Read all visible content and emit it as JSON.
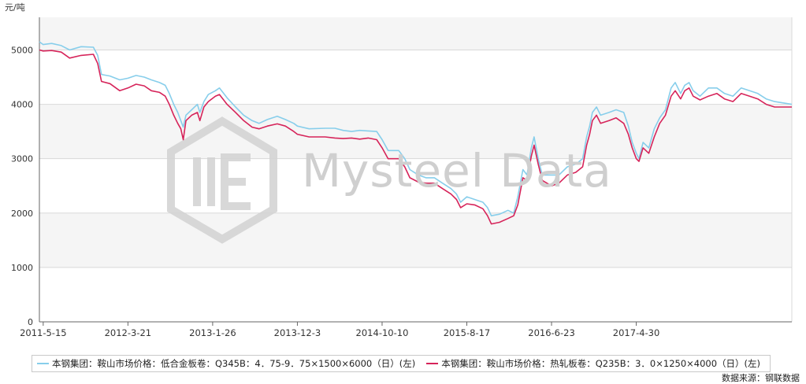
{
  "unit_label": "元/吨",
  "watermark": "Mysteel Data",
  "source": "数据来源：钢联数据",
  "legend": [
    {
      "label": "本钢集团：鞍山市场价格：低合金板卷：Q345B：4．75-9．75×1500×6000（日）(左)",
      "color": "#87ceeb"
    },
    {
      "label": "本钢集团：鞍山市场价格：热轧板卷：Q235B：3．0×1250×4000（日）(左)",
      "color": "#d6245a"
    }
  ],
  "colors": {
    "band": "#f5f5f5",
    "grid": "#d9d9d9",
    "axis": "#666666",
    "brand_mark": "#d4d4d4"
  },
  "chart_data": {
    "type": "line",
    "title": "",
    "xlabel": "",
    "ylabel": "元/吨",
    "ylim": [
      0,
      5600
    ],
    "yticks": [
      0,
      1000,
      2000,
      3000,
      4000,
      5000
    ],
    "xlim": [
      "2011-05-01",
      "2018-11-22"
    ],
    "xticks": [
      "2011-5-15",
      "2012-3-21",
      "2013-1-26",
      "2013-12-3",
      "2014-10-10",
      "2015-8-17",
      "2016-6-23",
      "2017-4-30"
    ],
    "grid": true,
    "legend_position": "bottom",
    "series": [
      {
        "name": "本钢集团：鞍山市场价格：低合金板卷：Q345B：4．75-9．75×1500×6000（日）(左)",
        "color": "#87ceeb",
        "points": [
          [
            "2011-05-01",
            5150
          ],
          [
            "2011-05-15",
            5100
          ],
          [
            "2011-06-15",
            5120
          ],
          [
            "2011-07-20",
            5080
          ],
          [
            "2011-08-20",
            5000
          ],
          [
            "2011-10-01",
            5060
          ],
          [
            "2011-11-15",
            5050
          ],
          [
            "2011-12-01",
            4900
          ],
          [
            "2011-12-15",
            4550
          ],
          [
            "2012-01-15",
            4520
          ],
          [
            "2012-02-20",
            4450
          ],
          [
            "2012-03-21",
            4480
          ],
          [
            "2012-04-20",
            4530
          ],
          [
            "2012-05-20",
            4500
          ],
          [
            "2012-06-15",
            4450
          ],
          [
            "2012-07-15",
            4400
          ],
          [
            "2012-08-05",
            4350
          ],
          [
            "2012-08-20",
            4200
          ],
          [
            "2012-09-05",
            4000
          ],
          [
            "2012-09-20",
            3850
          ],
          [
            "2012-10-01",
            3700
          ],
          [
            "2012-10-10",
            3580
          ],
          [
            "2012-10-20",
            3800
          ],
          [
            "2012-11-10",
            3900
          ],
          [
            "2012-12-01",
            4000
          ],
          [
            "2012-12-10",
            3850
          ],
          [
            "2012-12-25",
            4050
          ],
          [
            "2013-01-10",
            4180
          ],
          [
            "2013-02-05",
            4250
          ],
          [
            "2013-02-20",
            4300
          ],
          [
            "2013-03-20",
            4120
          ],
          [
            "2013-04-20",
            3950
          ],
          [
            "2013-05-20",
            3800
          ],
          [
            "2013-06-20",
            3700
          ],
          [
            "2013-07-15",
            3650
          ],
          [
            "2013-08-15",
            3720
          ],
          [
            "2013-09-20",
            3780
          ],
          [
            "2013-10-20",
            3720
          ],
          [
            "2013-11-20",
            3650
          ],
          [
            "2013-12-03",
            3600
          ],
          [
            "2014-01-15",
            3550
          ],
          [
            "2014-03-15",
            3560
          ],
          [
            "2014-04-20",
            3560
          ],
          [
            "2014-05-20",
            3520
          ],
          [
            "2014-06-20",
            3500
          ],
          [
            "2014-07-20",
            3520
          ],
          [
            "2014-08-20",
            3510
          ],
          [
            "2014-09-20",
            3500
          ],
          [
            "2014-10-10",
            3350
          ],
          [
            "2014-11-01",
            3150
          ],
          [
            "2014-12-10",
            3150
          ],
          [
            "2015-01-01",
            3000
          ],
          [
            "2015-01-20",
            2800
          ],
          [
            "2015-02-20",
            2700
          ],
          [
            "2015-03-20",
            2650
          ],
          [
            "2015-04-20",
            2650
          ],
          [
            "2015-05-20",
            2550
          ],
          [
            "2015-06-20",
            2450
          ],
          [
            "2015-07-10",
            2350
          ],
          [
            "2015-07-25",
            2200
          ],
          [
            "2015-08-17",
            2300
          ],
          [
            "2015-09-15",
            2250
          ],
          [
            "2015-10-15",
            2200
          ],
          [
            "2015-11-01",
            2100
          ],
          [
            "2015-11-15",
            1950
          ],
          [
            "2015-12-15",
            1980
          ],
          [
            "2016-01-15",
            2050
          ],
          [
            "2016-02-05",
            2000
          ],
          [
            "2016-02-20",
            2300
          ],
          [
            "2016-03-10",
            2800
          ],
          [
            "2016-03-25",
            2700
          ],
          [
            "2016-04-10",
            3200
          ],
          [
            "2016-04-20",
            3400
          ],
          [
            "2016-05-05",
            3000
          ],
          [
            "2016-05-20",
            2700
          ],
          [
            "2016-06-23",
            2700
          ],
          [
            "2016-07-20",
            2700
          ],
          [
            "2016-08-20",
            2850
          ],
          [
            "2016-09-20",
            2900
          ],
          [
            "2016-10-15",
            3000
          ],
          [
            "2016-10-30",
            3400
          ],
          [
            "2016-11-10",
            3600
          ],
          [
            "2016-11-20",
            3850
          ],
          [
            "2016-12-05",
            3950
          ],
          [
            "2016-12-20",
            3800
          ],
          [
            "2017-01-20",
            3850
          ],
          [
            "2017-02-15",
            3900
          ],
          [
            "2017-03-15",
            3850
          ],
          [
            "2017-04-01",
            3600
          ],
          [
            "2017-04-15",
            3300
          ],
          [
            "2017-04-30",
            3100
          ],
          [
            "2017-05-10",
            3000
          ],
          [
            "2017-05-25",
            3300
          ],
          [
            "2017-06-15",
            3200
          ],
          [
            "2017-07-05",
            3550
          ],
          [
            "2017-07-25",
            3750
          ],
          [
            "2017-08-15",
            3900
          ],
          [
            "2017-09-05",
            4300
          ],
          [
            "2017-09-20",
            4400
          ],
          [
            "2017-10-10",
            4200
          ],
          [
            "2017-10-25",
            4350
          ],
          [
            "2017-11-10",
            4400
          ],
          [
            "2017-11-25",
            4250
          ],
          [
            "2017-12-20",
            4150
          ],
          [
            "2018-01-20",
            4300
          ],
          [
            "2018-02-20",
            4300
          ],
          [
            "2018-03-20",
            4200
          ],
          [
            "2018-04-20",
            4150
          ],
          [
            "2018-05-20",
            4300
          ],
          [
            "2018-06-20",
            4250
          ],
          [
            "2018-07-20",
            4200
          ],
          [
            "2018-08-20",
            4100
          ],
          [
            "2018-09-20",
            4050
          ],
          [
            "2018-11-22",
            4000
          ]
        ]
      },
      {
        "name": "本钢集团：鞍山市场价格：热轧板卷：Q235B：3．0×1250×4000（日）(左)",
        "color": "#d6245a",
        "points": [
          [
            "2011-05-01",
            5000
          ],
          [
            "2011-05-15",
            4980
          ],
          [
            "2011-06-15",
            4990
          ],
          [
            "2011-07-20",
            4960
          ],
          [
            "2011-08-20",
            4850
          ],
          [
            "2011-10-01",
            4900
          ],
          [
            "2011-11-15",
            4920
          ],
          [
            "2011-12-01",
            4750
          ],
          [
            "2011-12-15",
            4420
          ],
          [
            "2012-01-15",
            4380
          ],
          [
            "2012-02-20",
            4250
          ],
          [
            "2012-03-21",
            4300
          ],
          [
            "2012-04-20",
            4370
          ],
          [
            "2012-05-20",
            4340
          ],
          [
            "2012-06-15",
            4250
          ],
          [
            "2012-07-15",
            4220
          ],
          [
            "2012-08-05",
            4150
          ],
          [
            "2012-08-20",
            4000
          ],
          [
            "2012-09-05",
            3800
          ],
          [
            "2012-09-20",
            3650
          ],
          [
            "2012-10-01",
            3550
          ],
          [
            "2012-10-10",
            3350
          ],
          [
            "2012-10-20",
            3700
          ],
          [
            "2012-11-10",
            3800
          ],
          [
            "2012-12-01",
            3850
          ],
          [
            "2012-12-10",
            3700
          ],
          [
            "2012-12-25",
            3950
          ],
          [
            "2013-01-10",
            4050
          ],
          [
            "2013-02-05",
            4150
          ],
          [
            "2013-02-20",
            4180
          ],
          [
            "2013-03-20",
            4000
          ],
          [
            "2013-04-20",
            3850
          ],
          [
            "2013-05-20",
            3700
          ],
          [
            "2013-06-20",
            3580
          ],
          [
            "2013-07-15",
            3550
          ],
          [
            "2013-08-15",
            3600
          ],
          [
            "2013-09-20",
            3640
          ],
          [
            "2013-10-20",
            3600
          ],
          [
            "2013-11-20",
            3500
          ],
          [
            "2013-12-03",
            3450
          ],
          [
            "2014-01-15",
            3400
          ],
          [
            "2014-03-15",
            3400
          ],
          [
            "2014-04-20",
            3380
          ],
          [
            "2014-05-20",
            3370
          ],
          [
            "2014-06-20",
            3380
          ],
          [
            "2014-07-20",
            3360
          ],
          [
            "2014-08-20",
            3380
          ],
          [
            "2014-09-20",
            3350
          ],
          [
            "2014-10-10",
            3200
          ],
          [
            "2014-11-01",
            3000
          ],
          [
            "2014-12-10",
            3000
          ],
          [
            "2015-01-01",
            2850
          ],
          [
            "2015-01-20",
            2650
          ],
          [
            "2015-02-20",
            2570
          ],
          [
            "2015-03-20",
            2550
          ],
          [
            "2015-04-20",
            2550
          ],
          [
            "2015-05-20",
            2450
          ],
          [
            "2015-06-20",
            2350
          ],
          [
            "2015-07-10",
            2250
          ],
          [
            "2015-07-25",
            2100
          ],
          [
            "2015-08-17",
            2170
          ],
          [
            "2015-09-15",
            2150
          ],
          [
            "2015-10-15",
            2080
          ],
          [
            "2015-11-01",
            1950
          ],
          [
            "2015-11-15",
            1800
          ],
          [
            "2015-12-15",
            1830
          ],
          [
            "2016-01-15",
            1900
          ],
          [
            "2016-02-05",
            1950
          ],
          [
            "2016-02-20",
            2150
          ],
          [
            "2016-03-10",
            2650
          ],
          [
            "2016-03-25",
            2600
          ],
          [
            "2016-04-10",
            3050
          ],
          [
            "2016-04-20",
            3250
          ],
          [
            "2016-05-05",
            2900
          ],
          [
            "2016-05-20",
            2600
          ],
          [
            "2016-06-23",
            2500
          ],
          [
            "2016-07-20",
            2550
          ],
          [
            "2016-08-20",
            2700
          ],
          [
            "2016-09-20",
            2750
          ],
          [
            "2016-10-15",
            2850
          ],
          [
            "2016-10-30",
            3250
          ],
          [
            "2016-11-10",
            3450
          ],
          [
            "2016-11-20",
            3700
          ],
          [
            "2016-12-05",
            3800
          ],
          [
            "2016-12-20",
            3650
          ],
          [
            "2017-01-20",
            3700
          ],
          [
            "2017-02-15",
            3750
          ],
          [
            "2017-03-15",
            3650
          ],
          [
            "2017-04-01",
            3450
          ],
          [
            "2017-04-15",
            3200
          ],
          [
            "2017-04-30",
            3000
          ],
          [
            "2017-05-10",
            2950
          ],
          [
            "2017-05-25",
            3200
          ],
          [
            "2017-06-15",
            3100
          ],
          [
            "2017-07-05",
            3400
          ],
          [
            "2017-07-25",
            3650
          ],
          [
            "2017-08-15",
            3800
          ],
          [
            "2017-09-05",
            4150
          ],
          [
            "2017-09-20",
            4250
          ],
          [
            "2017-10-10",
            4100
          ],
          [
            "2017-10-25",
            4250
          ],
          [
            "2017-11-10",
            4300
          ],
          [
            "2017-11-25",
            4150
          ],
          [
            "2017-12-20",
            4080
          ],
          [
            "2018-01-20",
            4150
          ],
          [
            "2018-02-20",
            4200
          ],
          [
            "2018-03-20",
            4100
          ],
          [
            "2018-04-20",
            4050
          ],
          [
            "2018-05-20",
            4200
          ],
          [
            "2018-06-20",
            4150
          ],
          [
            "2018-07-20",
            4100
          ],
          [
            "2018-08-20",
            4000
          ],
          [
            "2018-09-20",
            3950
          ],
          [
            "2018-11-22",
            3950
          ]
        ]
      }
    ]
  }
}
